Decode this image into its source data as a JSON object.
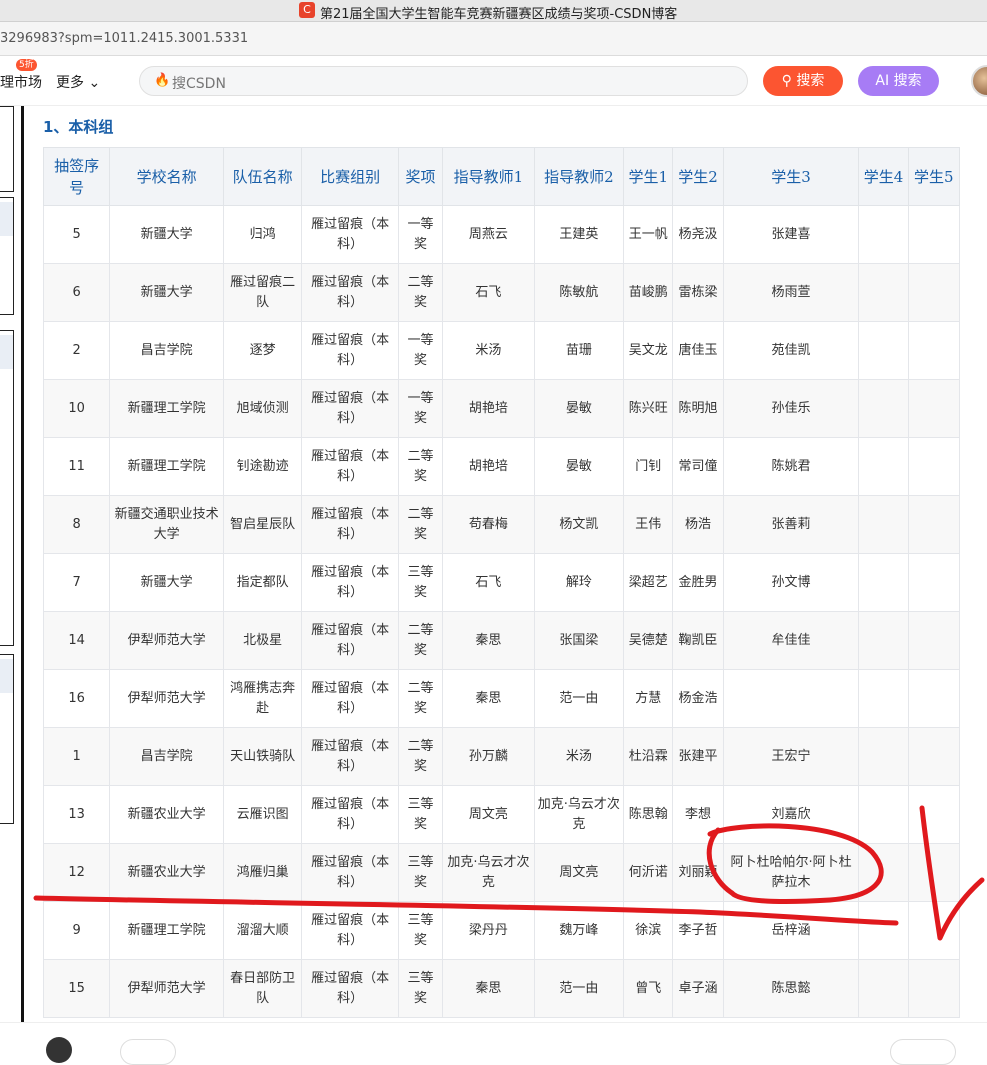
{
  "window": {
    "title": "第21届全国大学生智能车竞赛新疆赛区成绩与奖项-CSDN博客",
    "app_icon_glyph": "C"
  },
  "address_bar": {
    "url": "3296983?spm=1011.2415.3001.5331"
  },
  "nav": {
    "market_label": "理市场",
    "market_badge": "5折",
    "more_label": "更多 ⌄",
    "search_placeholder": "搜CSDN",
    "search_button": "搜索",
    "ai_search_button": "AI 搜索",
    "search_glyph": "⚲",
    "flame_glyph": "🔥"
  },
  "section": {
    "heading": "1、本科组"
  },
  "table": {
    "columns": [
      "抽签序号",
      "学校名称",
      "队伍名称",
      "比赛组别",
      "奖项",
      "指导教师1",
      "指导教师2",
      "学生1",
      "学生2",
      "学生3",
      "学生4",
      "学生5"
    ],
    "rows": [
      [
        "5",
        "新疆大学",
        "归鸿",
        "雁过留痕（本科）",
        "一等奖",
        "周燕云",
        "王建英",
        "王一帆",
        "杨尧汲",
        "张建喜",
        "",
        ""
      ],
      [
        "6",
        "新疆大学",
        "雁过留痕二队",
        "雁过留痕（本科）",
        "二等奖",
        "石飞",
        "陈敏航",
        "苗峻鹏",
        "雷栋梁",
        "杨雨萱",
        "",
        ""
      ],
      [
        "2",
        "昌吉学院",
        "逐梦",
        "雁过留痕（本科）",
        "一等奖",
        "米汤",
        "苗珊",
        "吴文龙",
        "唐佳玉",
        "苑佳凯",
        "",
        ""
      ],
      [
        "10",
        "新疆理工学院",
        "旭域侦测",
        "雁过留痕（本科）",
        "一等奖",
        "胡艳培",
        "晏敏",
        "陈兴旺",
        "陈明旭",
        "孙佳乐",
        "",
        ""
      ],
      [
        "11",
        "新疆理工学院",
        "钊途勘迹",
        "雁过留痕（本科）",
        "二等奖",
        "胡艳培",
        "晏敏",
        "门钊",
        "常司僮",
        "陈姚君",
        "",
        ""
      ],
      [
        "8",
        "新疆交通职业技术大学",
        "智启星辰队",
        "雁过留痕（本科）",
        "二等奖",
        "苟春梅",
        "杨文凯",
        "王伟",
        "杨浩",
        "张善莉",
        "",
        ""
      ],
      [
        "7",
        "新疆大学",
        "指定都队",
        "雁过留痕（本科）",
        "三等奖",
        "石飞",
        "解玲",
        "梁超艺",
        "金胜男",
        "孙文博",
        "",
        ""
      ],
      [
        "14",
        "伊犁师范大学",
        "北极星",
        "雁过留痕（本科）",
        "二等奖",
        "秦思",
        "张国梁",
        "吴德楚",
        "鞠凯臣",
        "牟佳佳",
        "",
        ""
      ],
      [
        "16",
        "伊犁师范大学",
        "鸿雁携志奔赴",
        "雁过留痕（本科）",
        "二等奖",
        "秦思",
        "范一由",
        "方慧",
        "杨金浩",
        "",
        "",
        ""
      ],
      [
        "1",
        "昌吉学院",
        "天山铁骑队",
        "雁过留痕（本科）",
        "二等奖",
        "孙万麟",
        "米汤",
        "杜沿霖",
        "张建平",
        "王宏宁",
        "",
        ""
      ],
      [
        "13",
        "新疆农业大学",
        "云雁识图",
        "雁过留痕（本科）",
        "三等奖",
        "周文亮",
        "加克·乌云才次克",
        "陈思翰",
        "李想",
        "刘嘉欣",
        "",
        ""
      ],
      [
        "12",
        "新疆农业大学",
        "鸿雁归巢",
        "雁过留痕（本科）",
        "三等奖",
        "加克·乌云才次克",
        "周文亮",
        "何沂诺",
        "刘丽颖",
        "阿卜杜哈帕尔·阿卜杜萨拉木",
        "",
        ""
      ],
      [
        "9",
        "新疆理工学院",
        "溜溜大顺",
        "雁过留痕（本科）",
        "三等奖",
        "梁丹丹",
        "魏万峰",
        "徐滨",
        "李子哲",
        "岳梓涵",
        "",
        ""
      ],
      [
        "15",
        "伊犁师范大学",
        "春日部防卫队",
        "雁过留痕（本科）",
        "三等奖",
        "秦思",
        "范一由",
        "曾飞",
        "卓子涵",
        "陈思懿",
        "",
        ""
      ]
    ]
  },
  "annotation_color": "#e0191d"
}
